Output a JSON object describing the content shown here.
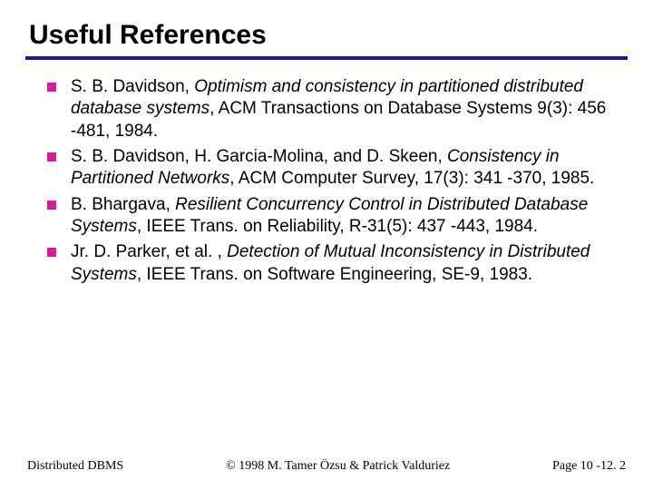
{
  "title": "Useful References",
  "references": [
    {
      "author_prefix": "S. B. Davidson, ",
      "italic_title": "Optimism and consistency in partitioned distributed database systems",
      "suffix": ", ACM Transactions on Database Systems 9(3): 456 -481, 1984."
    },
    {
      "author_prefix": "S. B. Davidson, H. Garcia-Molina, and D. Skeen, ",
      "italic_title": "Consistency in Partitioned Networks",
      "suffix": ", ACM Computer Survey, 17(3): 341 -370, 1985."
    },
    {
      "author_prefix": "B. Bhargava, ",
      "italic_title": "Resilient Concurrency Control in Distributed Database Systems",
      "suffix": ", IEEE Trans. on Reliability, R-31(5): 437 -443, 1984."
    },
    {
      "author_prefix": "Jr. D. Parker, et al. , ",
      "italic_title": "Detection of Mutual Inconsistency in Distributed Systems",
      "suffix": ", IEEE Trans. on Software Engineering, SE-9, 1983."
    }
  ],
  "footer": {
    "left": "Distributed DBMS",
    "center": "© 1998 M. Tamer Özsu & Patrick Valduriez",
    "right": "Page 10 -12. 2"
  }
}
